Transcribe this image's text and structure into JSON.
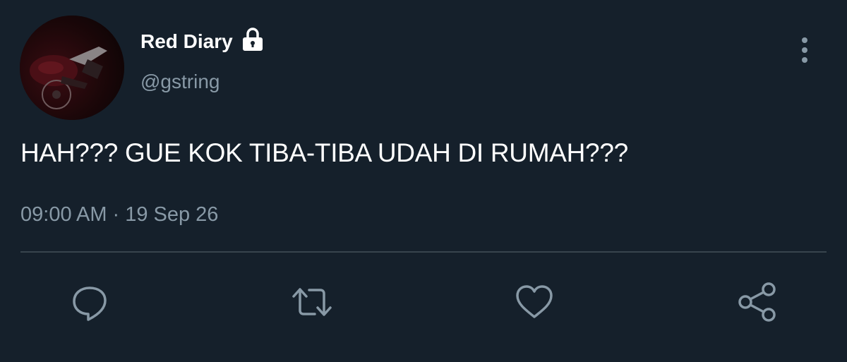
{
  "colors": {
    "background": "#15202b",
    "text_primary": "#ffffff",
    "text_secondary": "#8899a6",
    "divider": "#38444d"
  },
  "tweet": {
    "author": {
      "display_name": "Red Diary",
      "handle": "@gstring",
      "protected_icon": "lock-icon",
      "avatar": "avatar-image"
    },
    "text": "HAH??? GUE KOK TIBA-TIBA UDAH DI RUMAH???",
    "time": "09:00 AM",
    "separator": "·",
    "date": "19 Sep 26",
    "more_icon": "more-vertical-icon"
  },
  "actions": [
    {
      "icon": "reply-icon"
    },
    {
      "icon": "retweet-icon"
    },
    {
      "icon": "like-icon"
    },
    {
      "icon": "share-icon"
    }
  ]
}
